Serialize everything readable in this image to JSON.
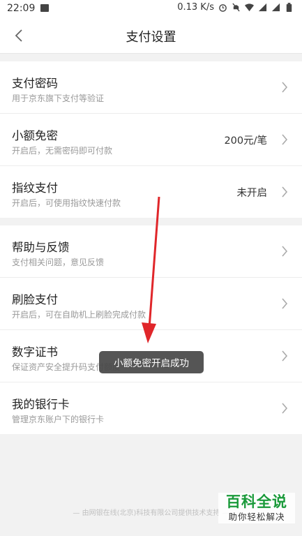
{
  "status_bar": {
    "time": "22:09",
    "network_speed": "0.13 K/s",
    "icons": [
      "image-icon",
      "alarm-icon",
      "mute-icon",
      "wifi-icon",
      "signal-icon",
      "signal-icon",
      "battery-icon"
    ]
  },
  "header": {
    "title": "支付设置",
    "back_icon": "back-chevron-icon"
  },
  "sections": [
    {
      "items": [
        {
          "label": "支付密码",
          "desc": "用于京东旗下支付等验证",
          "value": ""
        },
        {
          "label": "小额免密",
          "desc": "开启后，无需密码即可付款",
          "value": "200元/笔"
        },
        {
          "label": "指纹支付",
          "desc": "开启后，可使用指纹快速付款",
          "value": "未开启"
        }
      ]
    },
    {
      "items": [
        {
          "label": "帮助与反馈",
          "desc": "支付相关问题，意见反馈",
          "value": ""
        },
        {
          "label": "刷脸支付",
          "desc": "开启后，可在自助机上刷脸完成付款",
          "value": ""
        },
        {
          "label": "数字证书",
          "desc": "保证资产安全提升码支付额度",
          "value": ""
        },
        {
          "label": "我的银行卡",
          "desc": "管理京东账户下的银行卡",
          "value": ""
        }
      ]
    }
  ],
  "footer": "— 由网银在线(北京)科技有限公司提供技术支持 —",
  "toast": "小额免密开启成功",
  "colors": {
    "arrow": "#e0262a",
    "watermark": "#1a9a3a"
  },
  "watermark": {
    "title": "百科全说",
    "subtitle": "助你轻松解决"
  }
}
